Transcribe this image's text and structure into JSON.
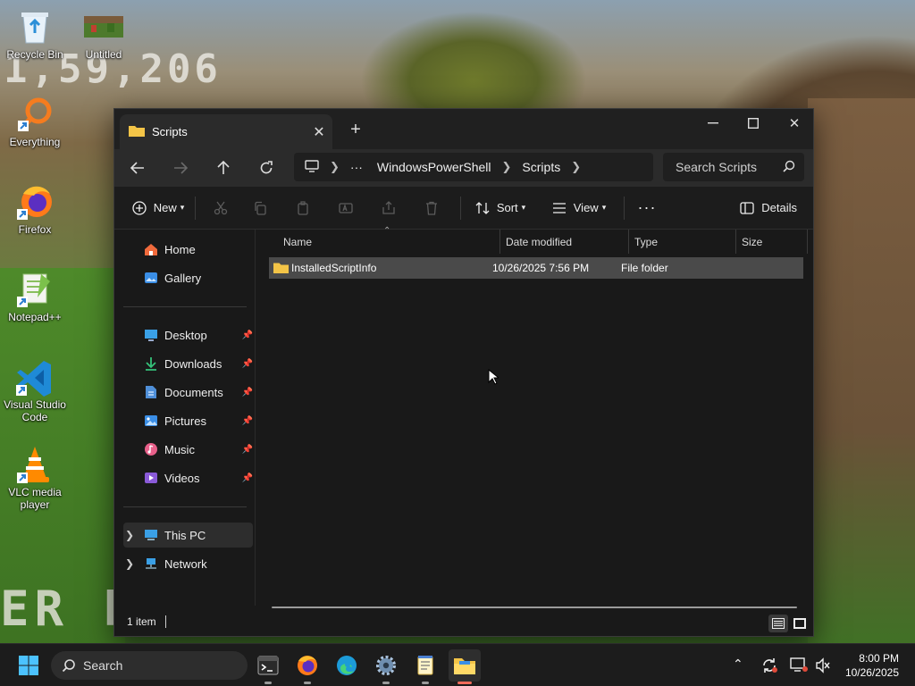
{
  "desktop": {
    "icons": [
      {
        "label": "Recycle Bin"
      },
      {
        "label": "Untitled"
      },
      {
        "label": "Everything"
      },
      {
        "label": "Firefox"
      },
      {
        "label": "Notepad++"
      },
      {
        "label": "Visual Studio Code"
      },
      {
        "label": "VLC media player"
      }
    ]
  },
  "window": {
    "tab_title": "Scripts",
    "address": {
      "segments": [
        "WindowsPowerShell",
        "Scripts"
      ]
    },
    "search_placeholder": "Search Scripts",
    "toolbar": {
      "new_label": "New",
      "sort_label": "Sort",
      "view_label": "View",
      "details_label": "Details"
    },
    "sidebar": {
      "items": [
        {
          "label": "Home"
        },
        {
          "label": "Gallery"
        },
        {
          "label": "Desktop"
        },
        {
          "label": "Downloads"
        },
        {
          "label": "Documents"
        },
        {
          "label": "Pictures"
        },
        {
          "label": "Music"
        },
        {
          "label": "Videos"
        },
        {
          "label": "This PC"
        },
        {
          "label": "Network"
        }
      ]
    },
    "columns": [
      "Name",
      "Date modified",
      "Type",
      "Size"
    ],
    "rows": [
      {
        "name": "InstalledScriptInfo",
        "date_modified": "10/26/2025 7:56 PM",
        "type": "File folder",
        "size": ""
      }
    ],
    "status_text": "1 item"
  },
  "taskbar": {
    "search_label": "Search",
    "time": "8:00 PM",
    "date": "10/26/2025"
  },
  "colors": {
    "window_bg": "#191919",
    "selected_row": "#4a4a4a",
    "folder_yellow": "#f3c447",
    "accent_blue": "#3a8ee6"
  }
}
